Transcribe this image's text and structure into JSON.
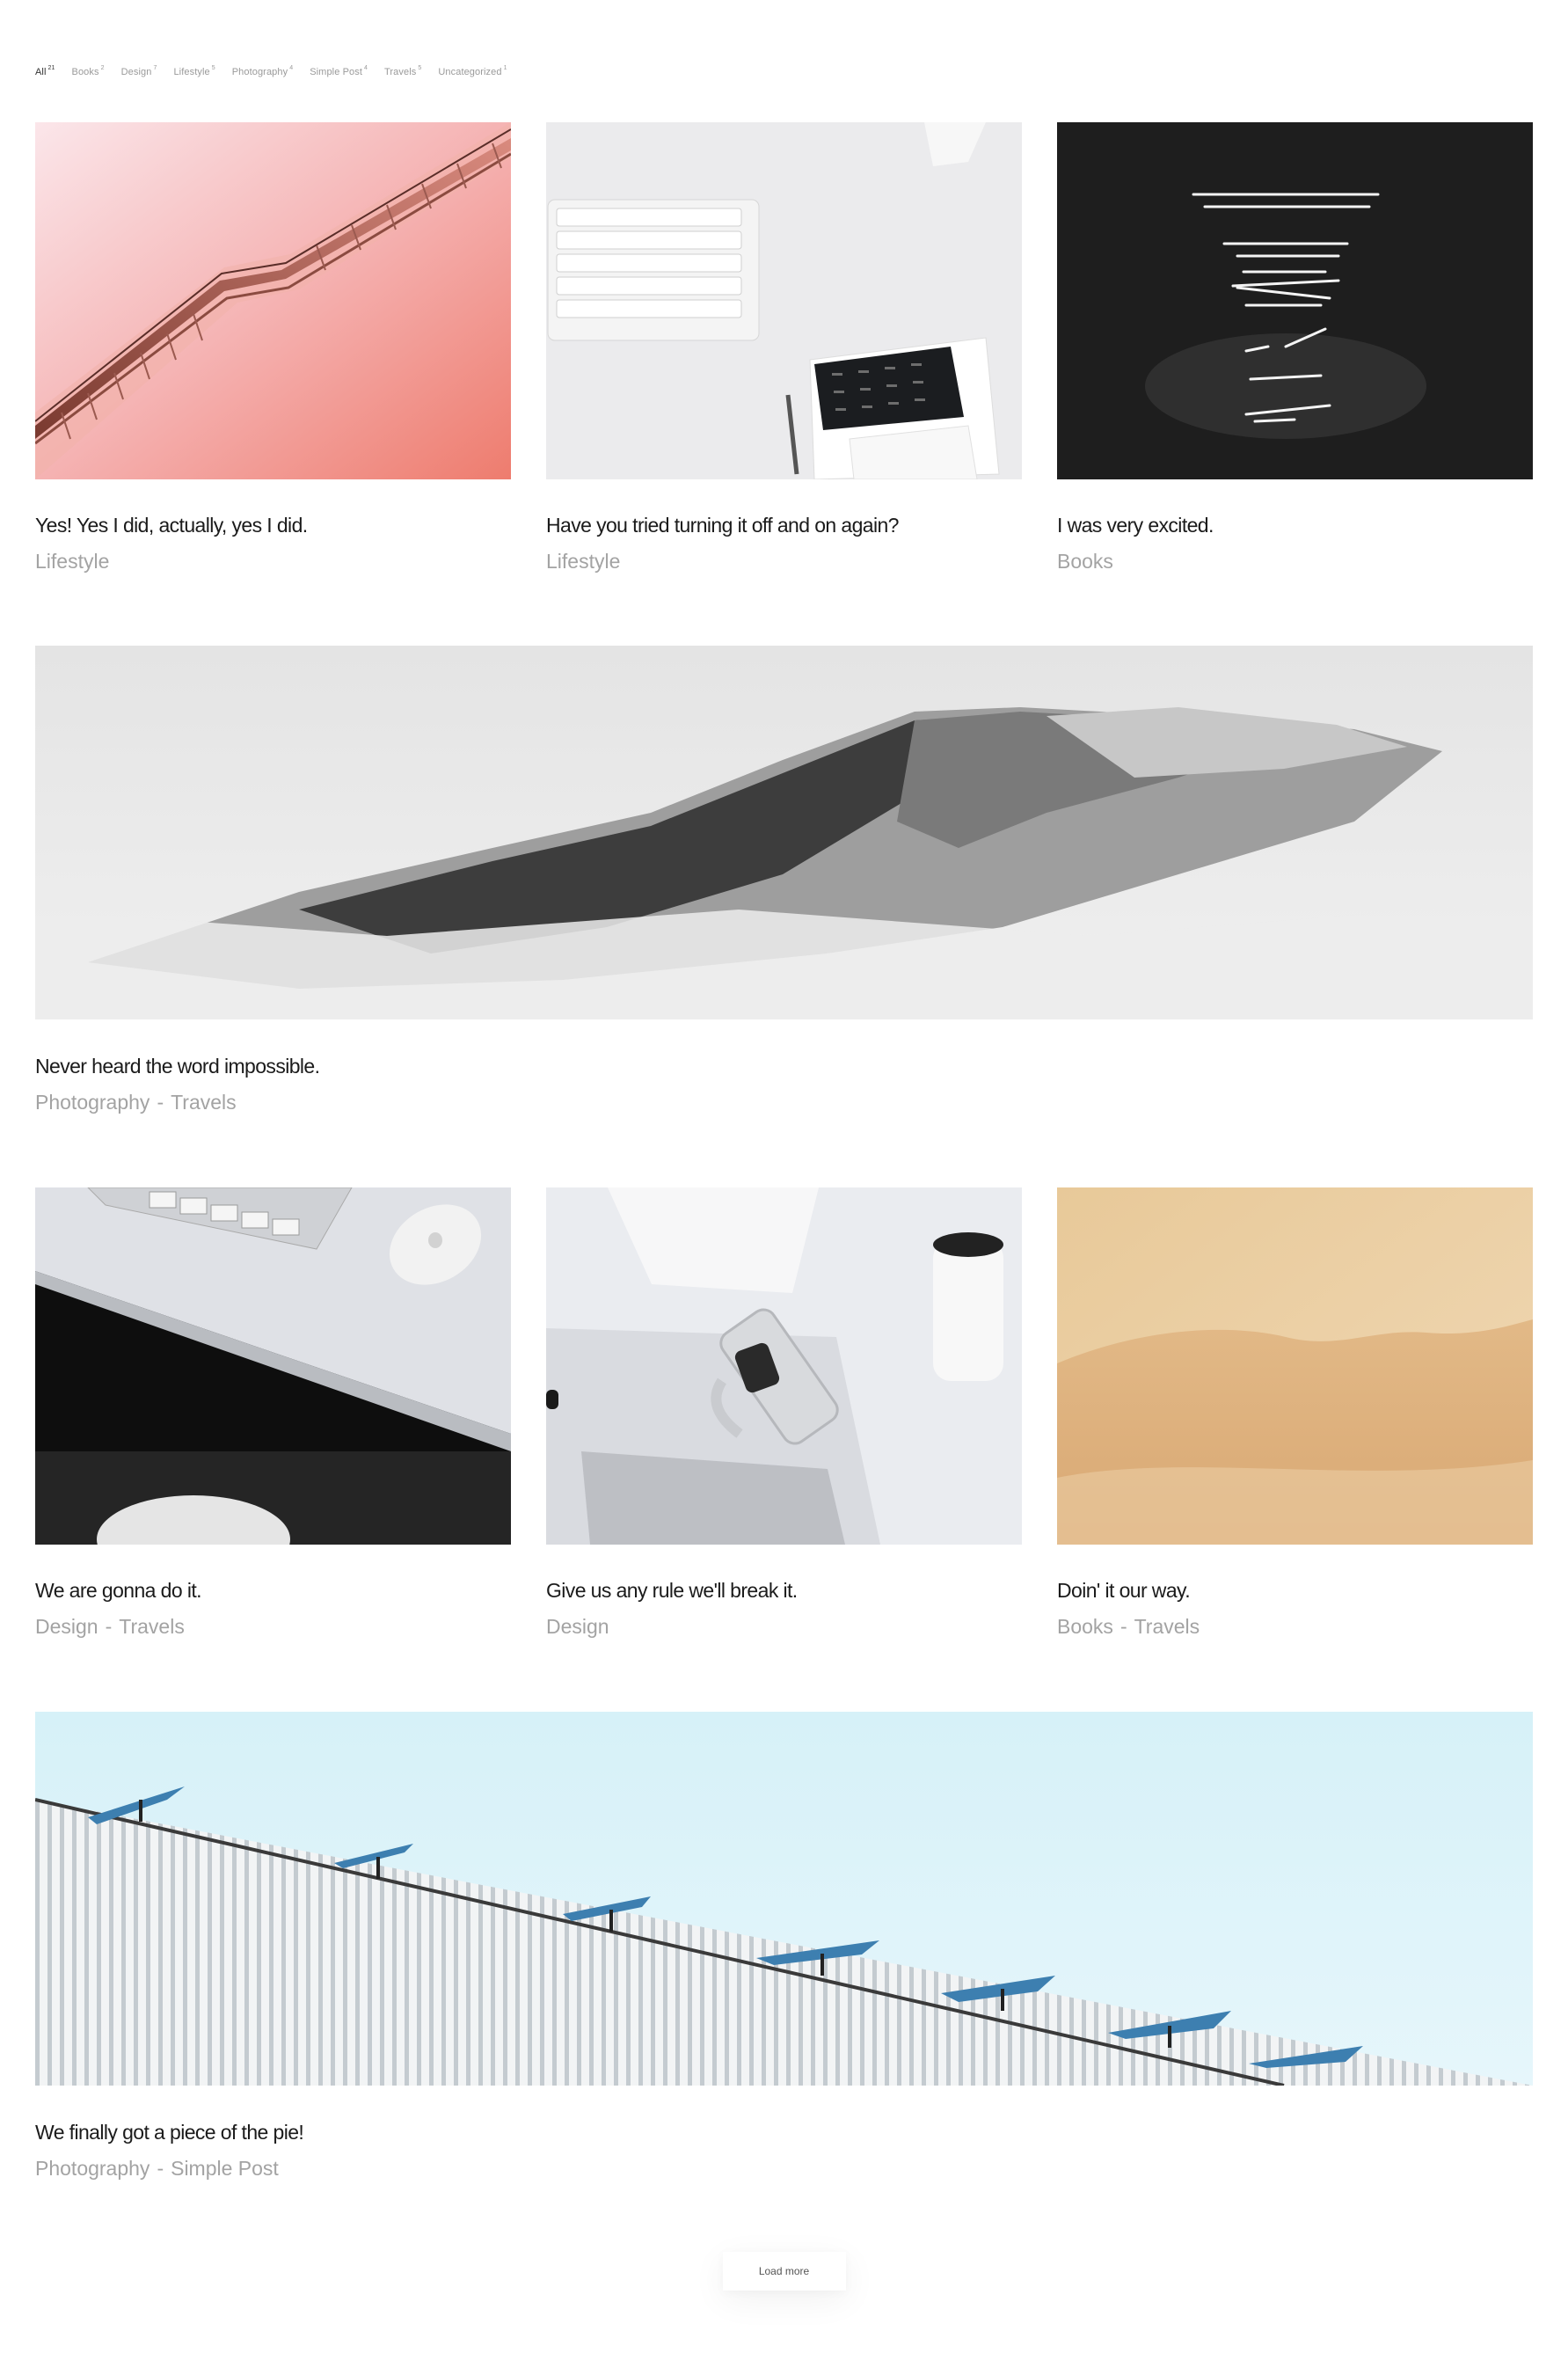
{
  "filters": [
    {
      "label": "All",
      "count": "21",
      "active": true
    },
    {
      "label": "Books",
      "count": "2"
    },
    {
      "label": "Design",
      "count": "7"
    },
    {
      "label": "Lifestyle",
      "count": "5"
    },
    {
      "label": "Photography",
      "count": "4"
    },
    {
      "label": "Simple Post",
      "count": "4"
    },
    {
      "label": "Travels",
      "count": "5"
    },
    {
      "label": "Uncategorized",
      "count": "1"
    }
  ],
  "posts": [
    {
      "title": "Yes! Yes I did, actually, yes I did.",
      "categories": [
        "Lifestyle"
      ],
      "image": "pink-escalator"
    },
    {
      "title": "Have you tried turning it off and on again?",
      "categories": [
        "Lifestyle"
      ],
      "image": "keyboard-desk"
    },
    {
      "title": "I was very excited.",
      "categories": [
        "Books"
      ],
      "image": "dark-light-lines"
    },
    {
      "title": "Never heard the word impossible.",
      "categories": [
        "Photography",
        "Travels"
      ],
      "image": "misty-mountain"
    },
    {
      "title": "We are gonna do it.",
      "categories": [
        "Design",
        "Travels"
      ],
      "image": "desk-mouse"
    },
    {
      "title": "Give us any rule we'll break it.",
      "categories": [
        "Design"
      ],
      "image": "watch-phone-desk"
    },
    {
      "title": "Doin' it our way.",
      "categories": [
        "Books",
        "Travels"
      ],
      "image": "sand-dune"
    },
    {
      "title": "We finally got a piece of the pie!",
      "categories": [
        "Photography",
        "Simple Post"
      ],
      "image": "solar-panels-roof"
    }
  ],
  "separator": "-",
  "load_more": "Load more"
}
